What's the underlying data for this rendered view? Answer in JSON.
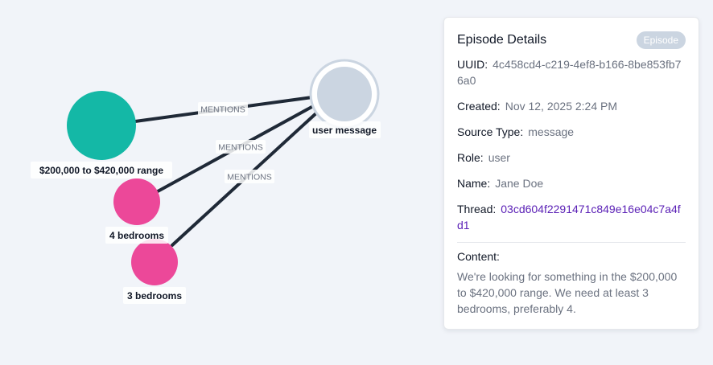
{
  "graph": {
    "edge_label": "MENTIONS",
    "nodes": {
      "user_message": "user message",
      "price_range": "$200,000 to $420,000 range",
      "bedrooms_4": "4 bedrooms",
      "bedrooms_3": "3 bedrooms"
    },
    "colors": {
      "episode_node": "#cbd5e1",
      "price_node": "#14b8a6",
      "bedroom_node": "#ec4899",
      "edge": "#1f2937"
    }
  },
  "details": {
    "title": "Episode Details",
    "badge": "Episode",
    "uuid_label": "UUID:",
    "uuid_value": "4c458cd4-c219-4ef8-b166-8be853fb76a0",
    "created_label": "Created:",
    "created_value": "Nov 12, 2025 2:24 PM",
    "source_label": "Source Type:",
    "source_value": "message",
    "role_label": "Role:",
    "role_value": "user",
    "name_label": "Name:",
    "name_value": "Jane Doe",
    "thread_label": "Thread:",
    "thread_value": "03cd604f2291471c849e16e04c7a4fd1",
    "content_label": "Content:",
    "content_value": "We're looking for something in the $200,000 to $420,000 range. We need at least 3 bedrooms, preferably 4."
  }
}
